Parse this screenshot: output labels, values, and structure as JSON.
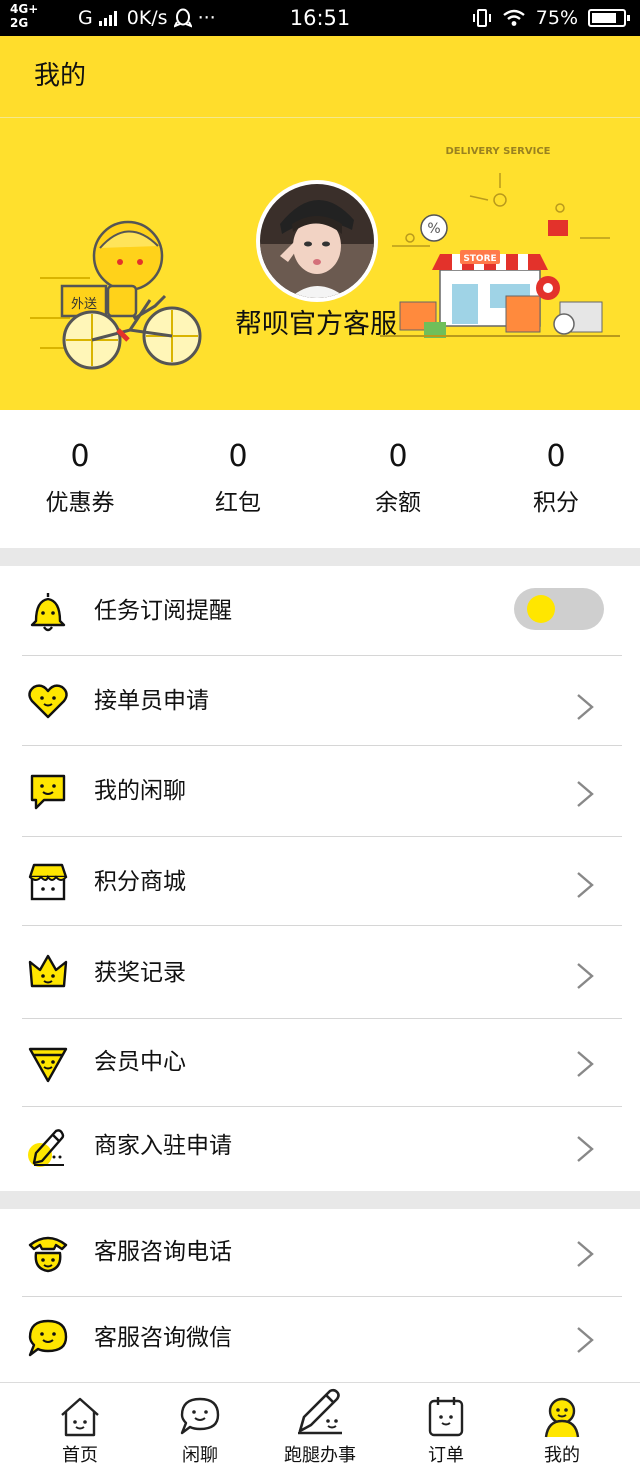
{
  "status_bar": {
    "network_top": "4G+",
    "network_bottom": "2G",
    "carrier_g": "G",
    "speed": "0K/s",
    "more": "···",
    "time": "16:51",
    "battery": "75%",
    "icons": [
      "signal-icon",
      "qq-icon",
      "vibrate-icon",
      "wifi-icon",
      "battery-icon"
    ]
  },
  "header": {
    "title": "我的"
  },
  "banner": {
    "username": "帮呗官方客服",
    "illustration_left_text": "外送",
    "illustration_right_title": "DELIVERY SERVICE",
    "illustration_store_text": "STORE",
    "illustration_percent": "%"
  },
  "stats": [
    {
      "value": "0",
      "label": "优惠券"
    },
    {
      "value": "0",
      "label": "红包"
    },
    {
      "value": "0",
      "label": "余额"
    },
    {
      "value": "0",
      "label": "积分"
    }
  ],
  "menu_group_1": [
    {
      "label": "任务订阅提醒",
      "icon": "bell-icon",
      "control": "toggle",
      "toggle_on": false
    },
    {
      "label": "接单员申请",
      "icon": "heart-face-icon",
      "control": "chevron"
    },
    {
      "label": "我的闲聊",
      "icon": "chat-face-icon",
      "control": "chevron"
    },
    {
      "label": "积分商城",
      "icon": "shop-icon",
      "control": "chevron"
    },
    {
      "label": "获奖记录",
      "icon": "crown-icon",
      "control": "chevron"
    },
    {
      "label": "会员中心",
      "icon": "badge-icon",
      "control": "chevron"
    },
    {
      "label": "商家入驻申请",
      "icon": "pencil-icon",
      "control": "chevron"
    }
  ],
  "menu_group_2": [
    {
      "label": "客服咨询电话",
      "icon": "phone-icon",
      "control": "chevron"
    },
    {
      "label": "客服咨询微信",
      "icon": "wechat-face-icon",
      "control": "chevron"
    }
  ],
  "tab_bar": [
    {
      "label": "首页",
      "icon": "home-icon",
      "active": false
    },
    {
      "label": "闲聊",
      "icon": "chat-icon",
      "active": false
    },
    {
      "label": "跑腿办事",
      "icon": "errand-icon",
      "active": false
    },
    {
      "label": "订单",
      "icon": "order-icon",
      "active": false
    },
    {
      "label": "我的",
      "icon": "profile-icon",
      "active": true
    }
  ],
  "colors": {
    "brand_yellow": "#ffdd2c",
    "separator": "#e8e8e8",
    "toggle_track": "#cfcfcf",
    "toggle_knob": "#ffe600"
  }
}
